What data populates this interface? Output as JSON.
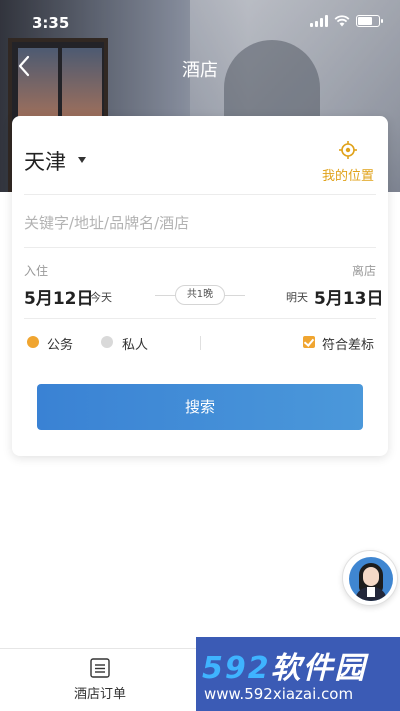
{
  "status_bar": {
    "time": "3:35"
  },
  "nav": {
    "title": "酒店"
  },
  "search_card": {
    "city": "天津",
    "my_location": "我的位置",
    "keyword_placeholder": "关键字/地址/品牌名/酒店",
    "checkin": {
      "label": "入住",
      "date": "5月12日",
      "day": "今天"
    },
    "nights": "共1晚",
    "checkout": {
      "label": "离店",
      "date": "5月13日",
      "day": "明天"
    },
    "trip_type": {
      "options": [
        {
          "label": "公务",
          "selected": true
        },
        {
          "label": "私人",
          "selected": false
        }
      ]
    },
    "policy_label": "符合差标",
    "policy_checked": true,
    "search_button": "搜索"
  },
  "tabbar": {
    "orders_label": "酒店订单"
  },
  "watermark": {
    "logo_num": "592",
    "logo_text": "软件园",
    "url": "www.592xiazai.com"
  },
  "colors": {
    "accent": "#f0a530",
    "primary": "#3a82d4",
    "location": "#e0a21a"
  }
}
